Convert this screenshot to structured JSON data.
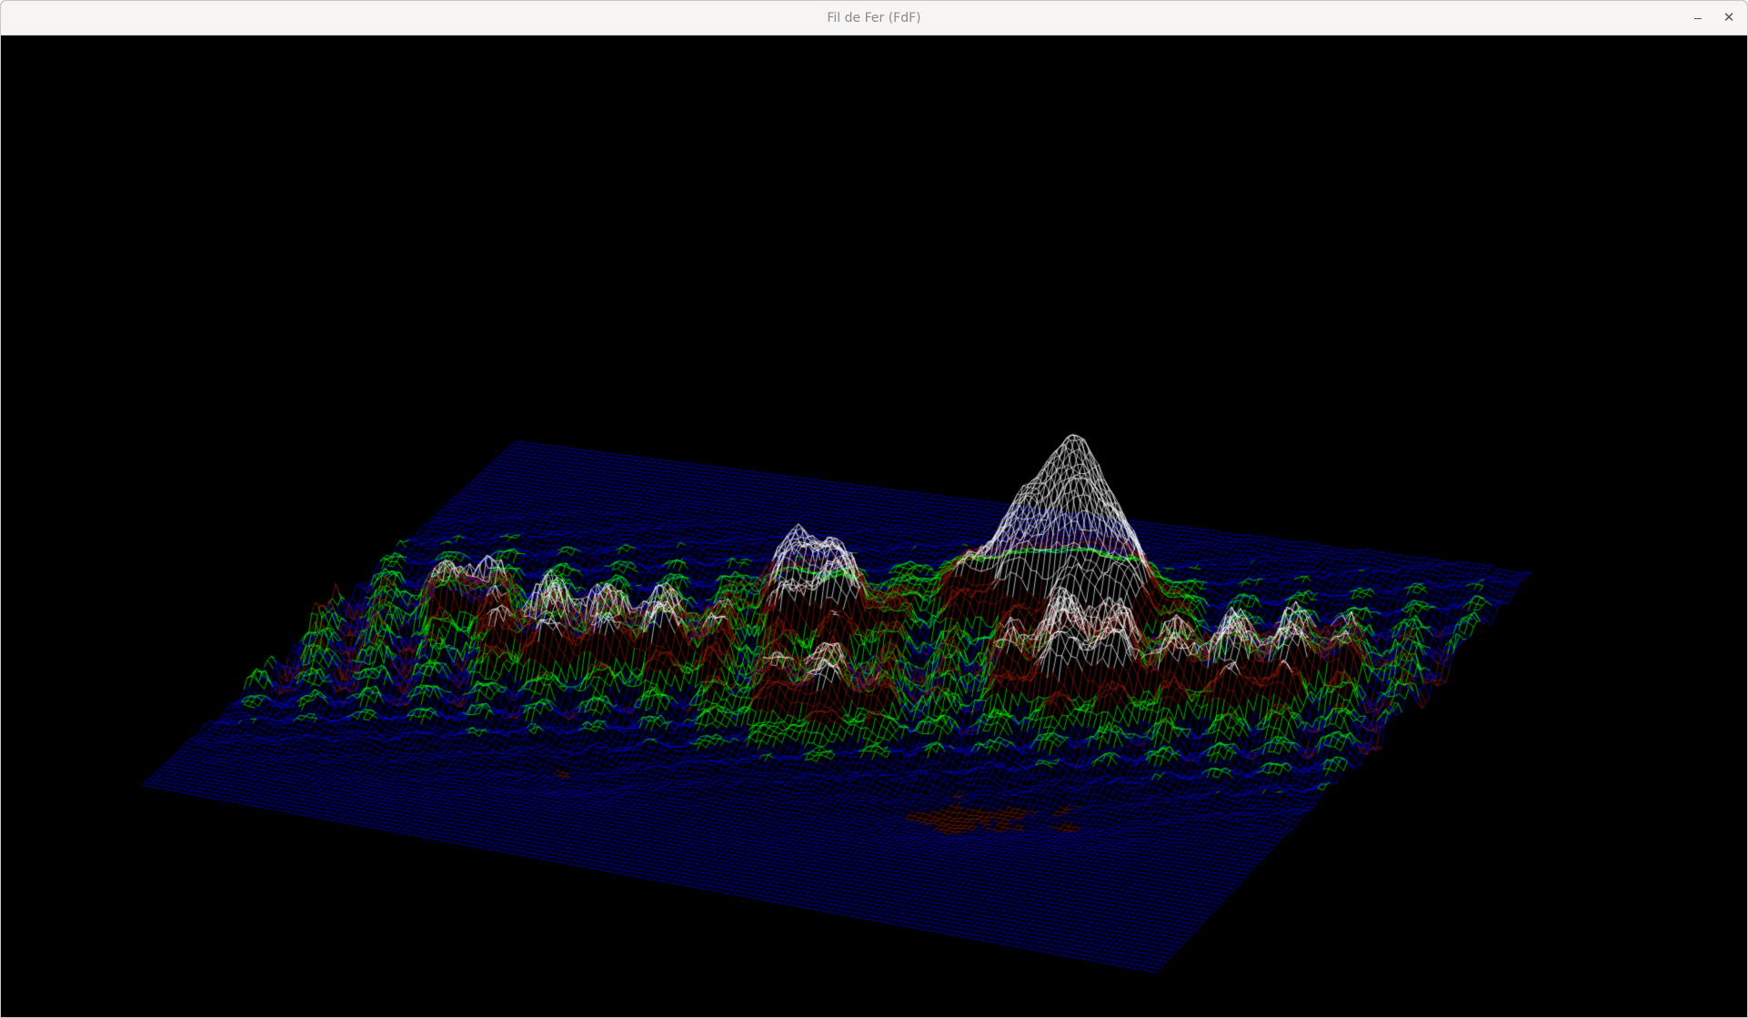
{
  "window": {
    "title": "Fil de Fer (FdF)",
    "minimize_glyph": "–",
    "close_glyph": "✕"
  },
  "render": {
    "background": "#000000",
    "palette": {
      "low": "#0000cc",
      "shore": "#00ff00",
      "hill": "#8b1a0a",
      "peak": "#ffffff"
    },
    "icons": [
      "minimize-icon",
      "close-icon"
    ]
  }
}
